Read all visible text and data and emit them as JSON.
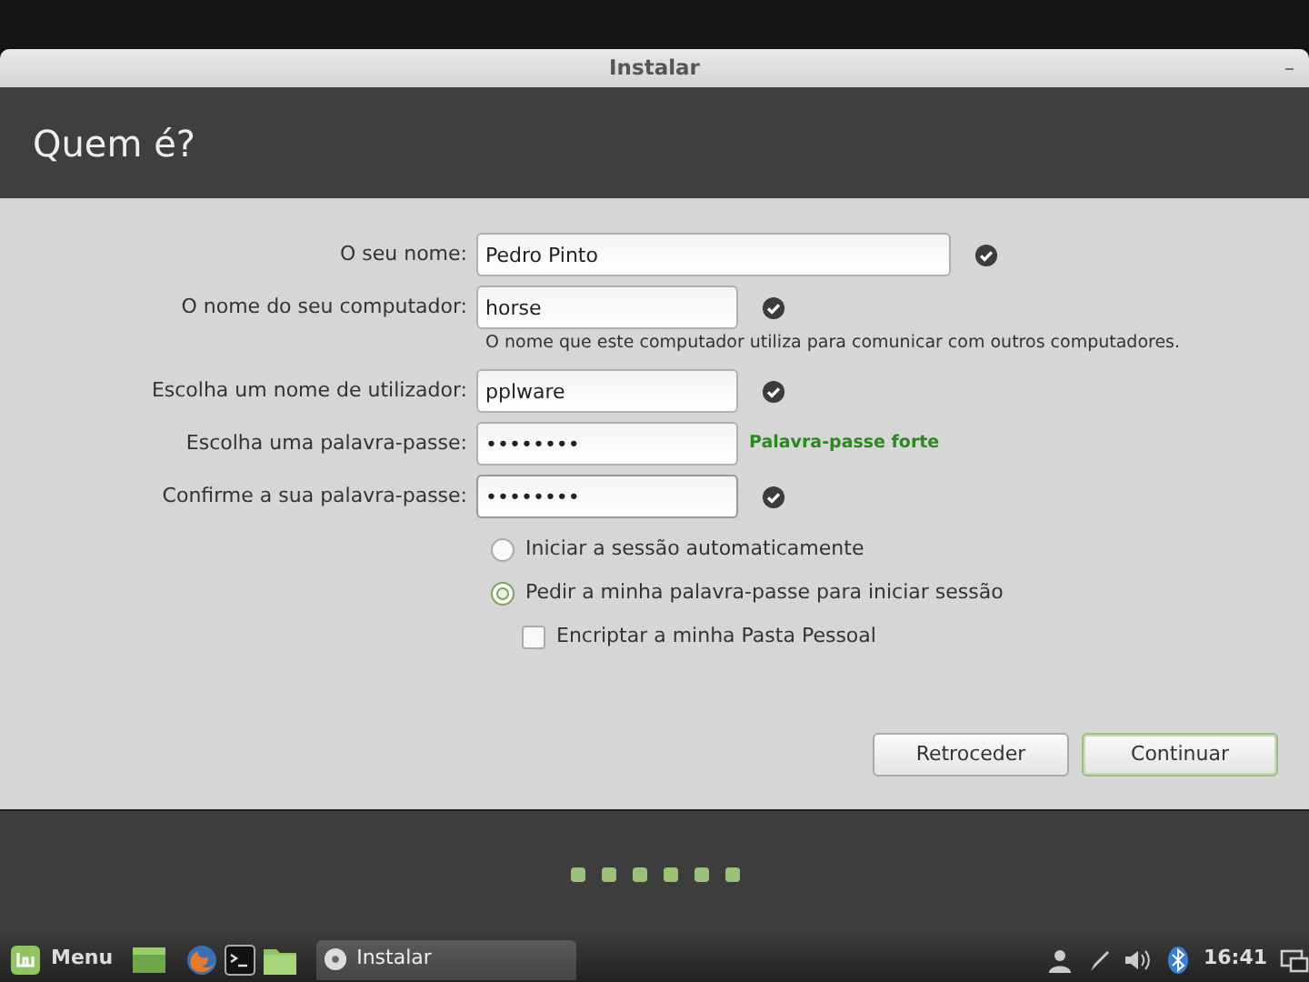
{
  "window": {
    "title": "Instalar",
    "minimize": "–"
  },
  "header": {
    "title": "Quem é?"
  },
  "fields": [
    {
      "label": "O seu nome:",
      "value": "Pedro Pinto",
      "wide": true,
      "valid": true
    },
    {
      "label": "O nome do seu computador:",
      "value": "horse",
      "wide": false,
      "valid": true,
      "hint": "O nome que este computador utiliza para comunicar com outros computadores."
    },
    {
      "label": "Escolha um nome de utilizador:",
      "value": "pplware",
      "wide": false,
      "valid": true
    },
    {
      "label": "Escolha uma palavra-passe:",
      "value": "••••••••",
      "wide": false,
      "valid": false,
      "strength": "Palavra-passe forte"
    },
    {
      "label": "Confirme a sua palavra-passe:",
      "value": "••••••••",
      "wide": false,
      "valid": true,
      "focused": true
    }
  ],
  "options": [
    {
      "kind": "radio",
      "label": "Iniciar a sessão automaticamente",
      "selected": false
    },
    {
      "kind": "radio",
      "label": "Pedir a minha palavra-passe para iniciar sessão",
      "selected": true
    },
    {
      "kind": "checkbox",
      "label": "Encriptar a minha Pasta Pessoal",
      "checked": false
    }
  ],
  "buttons": [
    {
      "label": "Retroceder",
      "default": false
    },
    {
      "label": "Continuar",
      "default": true
    }
  ],
  "taskbar": {
    "menu": "Menu",
    "task": "Instalar",
    "clock": "16:41"
  }
}
